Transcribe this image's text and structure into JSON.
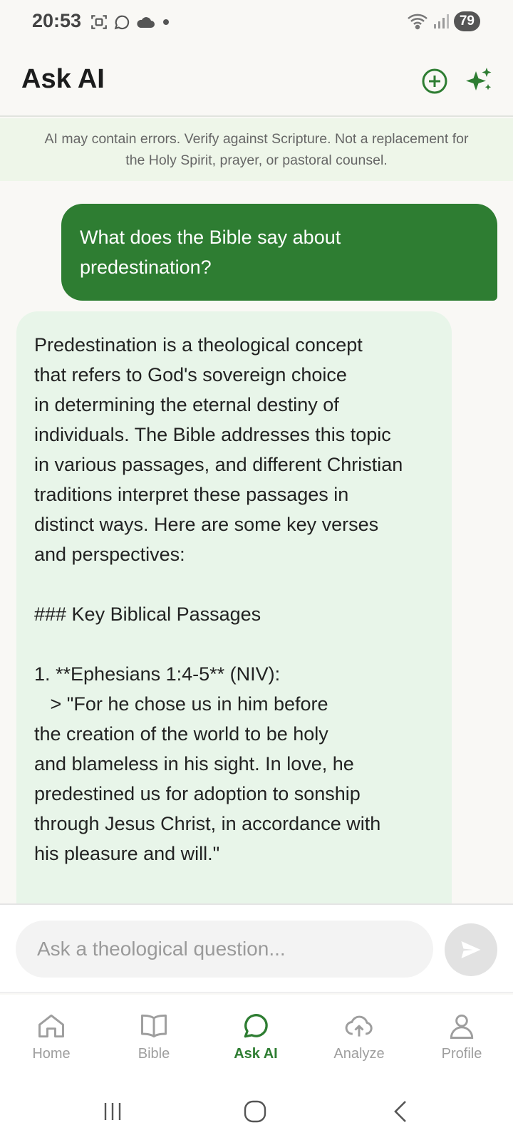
{
  "status_bar": {
    "time": "20:53",
    "battery": "79"
  },
  "header": {
    "title": "Ask AI",
    "new_chat_icon": "plus-circle-icon",
    "sparkle_icon": "sparkles-icon"
  },
  "disclaimer": {
    "line1": "AI may contain errors. Verify against Scripture. Not a replacement for",
    "line2": "the Holy Spirit, prayer, or pastoral counsel."
  },
  "messages": {
    "user": {
      "line1": "What does the Bible say about",
      "line2": "predestination?"
    },
    "ai": {
      "lines": [
        "Predestination is a theological concept",
        "that refers to God's sovereign choice",
        "in determining the eternal destiny of",
        "individuals. The Bible addresses this topic",
        "in various passages, and different Christian",
        "traditions interpret these passages in",
        "distinct ways. Here are some key verses",
        "and perspectives:",
        "",
        "### Key Biblical Passages",
        "",
        "1. **Ephesians 1:4-5** (NIV):",
        "   > \"For he chose us in him before",
        "the creation of the world to be holy",
        "and blameless in his sight. In love, he",
        "predestined us for adoption to sonship",
        "through Jesus Christ, in accordance with",
        "his pleasure and will.\""
      ]
    }
  },
  "composer": {
    "placeholder": "Ask a theological question...",
    "send_icon": "send-icon"
  },
  "bottom_nav": {
    "items": [
      {
        "label": "Home",
        "icon": "home-icon"
      },
      {
        "label": "Bible",
        "icon": "book-icon"
      },
      {
        "label": "Ask AI",
        "icon": "chat-icon"
      },
      {
        "label": "Analyze",
        "icon": "cloud-upload-icon"
      },
      {
        "label": "Profile",
        "icon": "person-icon"
      }
    ],
    "active": "Ask AI"
  },
  "colors": {
    "accent": "#2e7d32",
    "ai_bubble": "#e8f5e9",
    "disclaimer_bg": "#eef6e9"
  }
}
